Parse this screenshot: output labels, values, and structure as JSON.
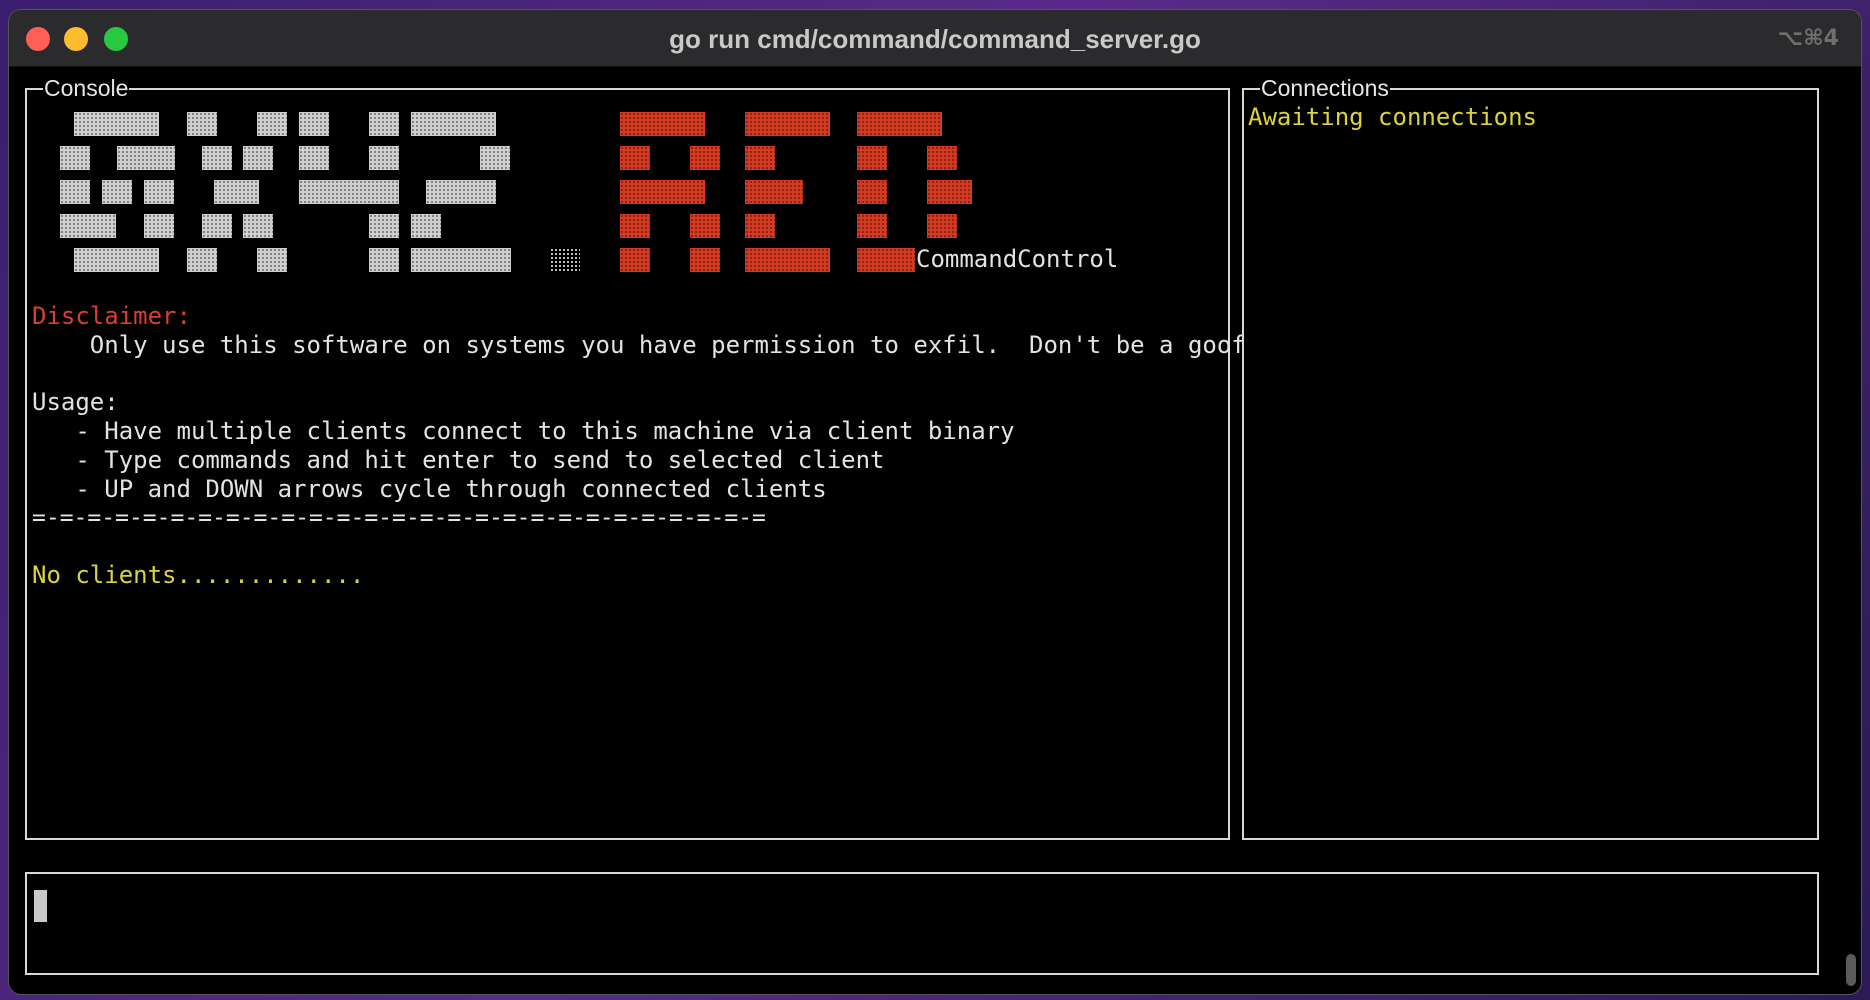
{
  "window": {
    "title": "go run cmd/command/command_server.go",
    "shortcut": "⌥⌘4"
  },
  "console": {
    "title": "Console",
    "banner_suffix": "CommandControl",
    "disclaimer_label": "Disclaimer:",
    "disclaimer_text": "    Only use this software on systems you have permission to exfil.  Don't be a goof",
    "usage_label": "Usage:",
    "usage_items": [
      "   - Have multiple clients connect to this machine via client binary",
      "   - Type commands and hit enter to send to selected client",
      "   - UP and DOWN arrows cycle through connected clients"
    ],
    "separator": "=-=-=-=-=-=-=-=-=-=-=-=-=-=-=-=-=-=-=-=-=-=-=-=-=-=-=",
    "status": "No clients............."
  },
  "connections": {
    "title": "Connections",
    "status": "Awaiting connections"
  },
  "input": {
    "value": ""
  },
  "colors": {
    "terminal_bg": "#000000",
    "text": "#e3e3e3",
    "red": "#d9402b",
    "yellow": "#dcd33c",
    "banner_gray": "#cfcfcf",
    "banner_red": "#d23a22"
  }
}
